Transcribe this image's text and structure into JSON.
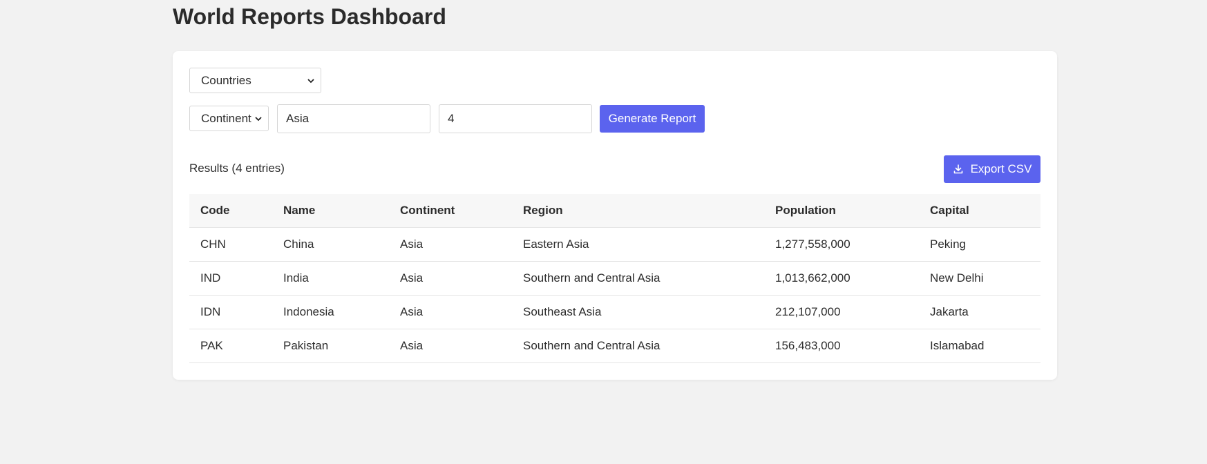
{
  "page": {
    "title": "World Reports Dashboard"
  },
  "controls": {
    "report_type": {
      "selected": "Countries"
    },
    "filter_field": {
      "selected": "Continent"
    },
    "filter_value": {
      "value": "Asia"
    },
    "limit": {
      "value": "4"
    },
    "generate_label": "Generate Report"
  },
  "results": {
    "summary": "Results (4 entries)",
    "export_label": "Export CSV",
    "columns": [
      "Code",
      "Name",
      "Continent",
      "Region",
      "Population",
      "Capital"
    ],
    "rows": [
      [
        "CHN",
        "China",
        "Asia",
        "Eastern Asia",
        "1,277,558,000",
        "Peking"
      ],
      [
        "IND",
        "India",
        "Asia",
        "Southern and Central Asia",
        "1,013,662,000",
        "New Delhi"
      ],
      [
        "IDN",
        "Indonesia",
        "Asia",
        "Southeast Asia",
        "212,107,000",
        "Jakarta"
      ],
      [
        "PAK",
        "Pakistan",
        "Asia",
        "Southern and Central Asia",
        "156,483,000",
        "Islamabad"
      ]
    ]
  },
  "icons": {
    "select_chevron": "chevron-down-icon",
    "export": "download-icon"
  },
  "colors": {
    "accent": "#5b63ee",
    "background": "#f2f2f2",
    "card": "#ffffff",
    "header_row": "#f7f7f7"
  }
}
